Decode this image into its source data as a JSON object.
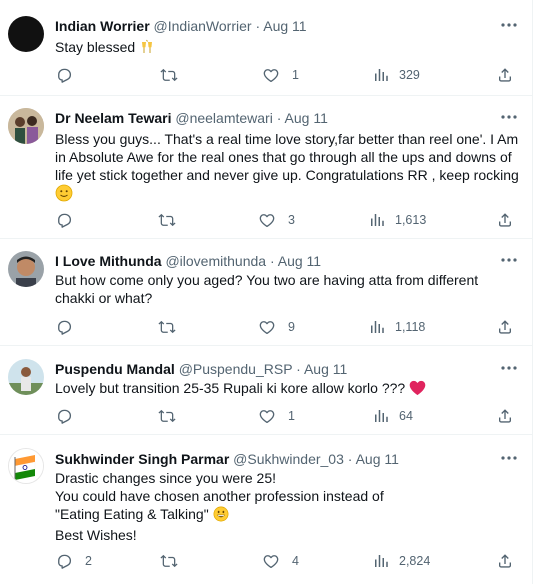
{
  "tweets": [
    {
      "name": "Indian Worrier",
      "handle": "@IndianWorrier",
      "dot": "·",
      "date": "Aug 11",
      "lines": [
        "Stay blessed"
      ],
      "avatar_style": "dark",
      "replies": "",
      "retweets": "",
      "likes": "1",
      "views": "329"
    },
    {
      "name": "Dr Neelam Tewari",
      "handle": "@neelamtewari",
      "dot": "·",
      "date": "Aug 11",
      "lines": [
        "Bless you guys... That's a real time love story,far better than reel one'. I Am",
        "in Absolute Awe for the real ones that go through all the ups and downs of",
        "life yet stick together and never give up. Congratulations RR , keep rocking"
      ],
      "avatar_style": "photo-couple",
      "replies": "",
      "retweets": "",
      "likes": "3",
      "views": "1,613"
    },
    {
      "name": "I Love Mithunda",
      "handle": "@ilovemithunda",
      "dot": "·",
      "date": "Aug 11",
      "lines": [
        "But how come only you aged? You two are having atta from different",
        "chakki or what?"
      ],
      "avatar_style": "photo-face",
      "replies": "",
      "retweets": "",
      "likes": "9",
      "views": "1,118"
    },
    {
      "name": "Puspendu Mandal",
      "handle": "@Puspendu_RSP",
      "dot": "·",
      "date": "Aug 11",
      "lines": [
        "Lovely but transition 25-35 Rupali ki kore allow korlo  ???"
      ],
      "avatar_style": "photo-outdoor",
      "replies": "",
      "retweets": "",
      "likes": "1",
      "views": "64"
    },
    {
      "name": "Sukhwinder Singh Parmar",
      "handle": "@Sukhwinder_03",
      "dot": "·",
      "date": "Aug 11",
      "lines": [
        "Drastic changes since you were 25!",
        "You could have chosen another profession instead of",
        "\"Eating Eating & Talking\"",
        "Best Wishes!"
      ],
      "avatar_style": "flag",
      "replies": "2",
      "retweets": "",
      "likes": "4",
      "views": "2,824"
    }
  ],
  "icons": {
    "more": "more-horizontal-icon",
    "reply": "reply-bubble-icon",
    "retweet": "retweet-icon",
    "like": "heart-icon",
    "views": "views-bar-chart-icon",
    "share": "share-upload-icon",
    "emoji_cheers": "clinking-glasses-emoji",
    "emoji_smile": "slightly-smiling-face-emoji",
    "emoji_heart": "red-heart-emoji",
    "emoji_grin": "grinning-face-emoji"
  },
  "colors": {
    "text_primary": "#0f1419",
    "text_secondary": "#536471",
    "divider": "#eff3f4",
    "heart_red": "#e0245e",
    "emoji_yellow": "#ffcc33"
  }
}
